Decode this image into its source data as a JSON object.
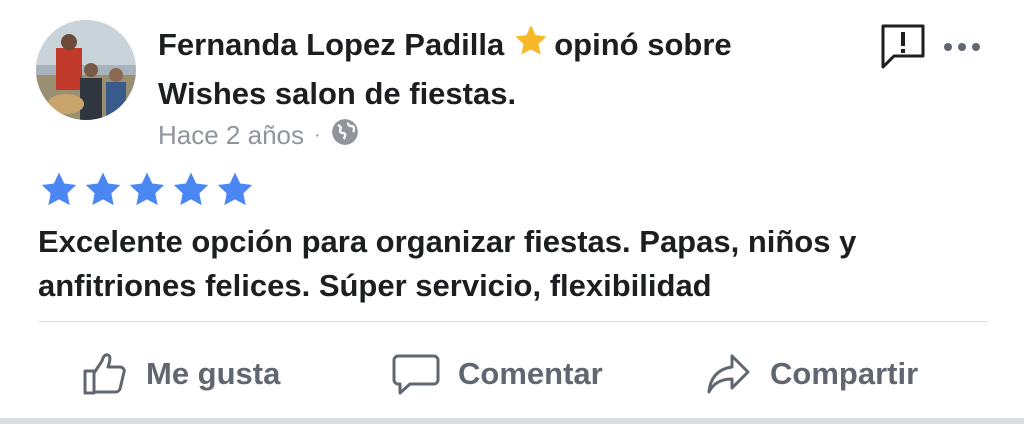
{
  "post": {
    "author": "Fernanda Lopez Padilla",
    "action_text": "opinó sobre",
    "page_name": "Wishes salon de fiestas.",
    "timestamp": "Hace 2 años",
    "separator": "·",
    "privacy_icon": "globe-icon",
    "rating_stars": 5,
    "rating_max": 5,
    "review_text": "Excelente opción para organizar fiestas. Papas, niños y anfitriones felices. Súper servicio, flexibilidad"
  },
  "actions": {
    "like_label": "Me gusta",
    "comment_label": "Comentar",
    "share_label": "Compartir"
  },
  "colors": {
    "star_blue": "#4a87f2",
    "badge_gold": "#f7b928",
    "text_primary": "#1c1e21",
    "text_secondary": "#90949c",
    "action_gray": "#606770"
  }
}
